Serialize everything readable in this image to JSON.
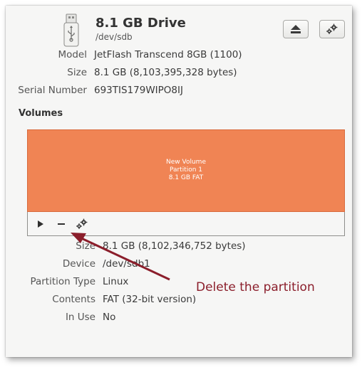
{
  "drive": {
    "title": "8.1 GB Drive",
    "device": "/dev/sdb",
    "icon": "usb-drive-icon"
  },
  "header_buttons": {
    "eject_icon": "eject-icon",
    "settings_icon": "gear-icon"
  },
  "drive_info": {
    "model_label": "Model",
    "model_value": "JetFlash Transcend 8GB (1100)",
    "size_label": "Size",
    "size_value": "8.1 GB (8,103,395,328 bytes)",
    "serial_label": "Serial Number",
    "serial_value": "693TIS179WIPO8IJ"
  },
  "volumes": {
    "heading": "Volumes",
    "partition": {
      "name": "New Volume",
      "number": "Partition 1",
      "size_fs": "8.1 GB FAT",
      "color": "#f08454"
    },
    "toolbar": {
      "play_icon": "play-icon",
      "delete_icon": "minus-icon",
      "settings_icon": "gears-icon"
    }
  },
  "partition_info": {
    "size_label": "Size",
    "size_value": "8.1 GB (8,102,346,752 bytes)",
    "device_label": "Device",
    "device_value": "/dev/sdb1",
    "type_label": "Partition Type",
    "type_value": "Linux",
    "contents_label": "Contents",
    "contents_value": "FAT (32-bit version)",
    "inuse_label": "In Use",
    "inuse_value": "No"
  },
  "annotation": {
    "text": "Delete the partition",
    "color": "#8b1e2b"
  }
}
